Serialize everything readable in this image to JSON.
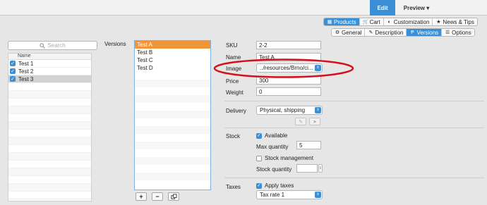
{
  "topbar": {
    "edit_label": "Edit",
    "preview_label": "Preview",
    "preview_arrow": "▾"
  },
  "main_tabs": [
    {
      "icon": "products-icon",
      "glyph": "▦",
      "label": "Products",
      "active": true
    },
    {
      "icon": "cart-icon",
      "glyph": "🛒",
      "label": "Cart",
      "active": false
    },
    {
      "icon": "customization-icon",
      "glyph": "◐",
      "label": "Customization",
      "active": false
    },
    {
      "icon": "star-icon",
      "glyph": "★",
      "label": "News & Tips",
      "active": false
    }
  ],
  "sub_tabs": [
    {
      "icon": "gear-icon",
      "glyph": "⚙",
      "label": "General",
      "active": false
    },
    {
      "icon": "description-icon",
      "glyph": "✎",
      "label": "Description",
      "active": false
    },
    {
      "icon": "versions-icon",
      "glyph": "Ᵽ",
      "label": "Versions",
      "active": true
    },
    {
      "icon": "options-icon",
      "glyph": "☰",
      "label": "Options",
      "active": false
    }
  ],
  "search": {
    "placeholder": "Search"
  },
  "product_list": {
    "header": "Name",
    "items": [
      {
        "label": "Test 1",
        "checked": true
      },
      {
        "label": "Test 2",
        "checked": true
      },
      {
        "label": "Test 3",
        "checked": true,
        "selected": true
      }
    ]
  },
  "versions": {
    "label": "Versions",
    "items": [
      "Test A",
      "Test B",
      "Test C",
      "Test D"
    ],
    "selected": "Test A",
    "add": "+",
    "remove": "−"
  },
  "form": {
    "sku_label": "SKU",
    "sku": "2-2",
    "name_label": "Name",
    "name": "Test A",
    "image_label": "Image",
    "image": "../resources/Brno/ci...",
    "price_label": "Price",
    "price": "300",
    "weight_label": "Weight",
    "weight": "0",
    "delivery_label": "Delivery",
    "delivery": "Physical, shipping",
    "stock_label": "Stock",
    "available_label": "Available",
    "available": true,
    "max_qty_label": "Max quantity",
    "max_qty": "5",
    "stock_mgmt_label": "Stock management",
    "stock_mgmt": false,
    "stock_qty_label": "Stock quantity",
    "stock_qty": "",
    "taxes_label": "Taxes",
    "apply_taxes_label": "Apply taxes",
    "apply_taxes": true,
    "tax_rate": "Tax rate 1"
  },
  "colors": {
    "accent": "#3b8fd6",
    "selection": "#f1953b",
    "annotation": "#d4101a"
  }
}
